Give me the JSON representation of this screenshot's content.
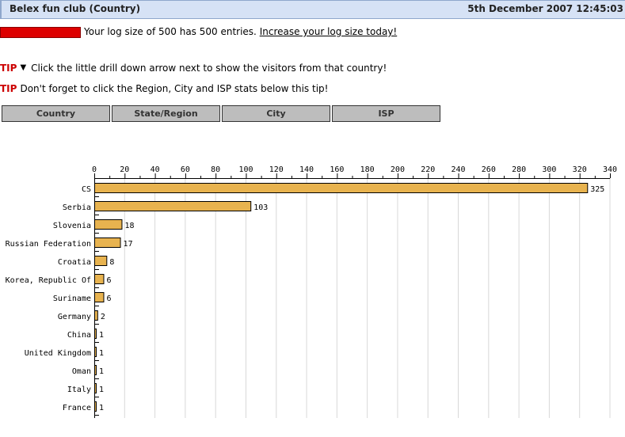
{
  "header": {
    "title": "Belex fun club (Country)",
    "datetime": "5th December 2007 12:45:03"
  },
  "log": {
    "fill_fraction": 1.0,
    "bar_color": "#dd0000",
    "message": "Your log size of 500 has 500 entries.",
    "link_label": "Increase your log size today!"
  },
  "tips": [
    {
      "label": "TIP",
      "icon": "drill-down-arrow-icon",
      "text": "Click the little drill down arrow next to show the visitors from that country!"
    },
    {
      "label": "TIP",
      "text": "Don't forget to click the Region, City and ISP stats below this tip!"
    }
  ],
  "tabs": [
    {
      "label": "Country"
    },
    {
      "label": "State/Region"
    },
    {
      "label": "City"
    },
    {
      "label": "ISP"
    }
  ],
  "chart_data": {
    "type": "bar",
    "orientation": "horizontal",
    "title": "",
    "xlabel": "",
    "ylabel": "",
    "categories": [
      "CS",
      "Serbia",
      "Slovenia",
      "Russian Federation",
      "Croatia",
      "Korea, Republic Of",
      "Suriname",
      "Germany",
      "China",
      "United Kingdom",
      "Oman",
      "Italy",
      "France"
    ],
    "values": [
      325,
      103,
      18,
      17,
      8,
      6,
      6,
      2,
      1,
      1,
      1,
      1,
      1
    ],
    "xlim": [
      0,
      340
    ],
    "xticks": [
      0,
      20,
      40,
      60,
      80,
      100,
      120,
      140,
      160,
      180,
      200,
      220,
      240,
      260,
      280,
      300,
      320,
      340
    ],
    "axis_position": "top",
    "grid": true,
    "data_labels": true,
    "bar_color": "#e8b34f",
    "bar_border_color": "#000000",
    "grid_color": "#d8d8d8"
  }
}
